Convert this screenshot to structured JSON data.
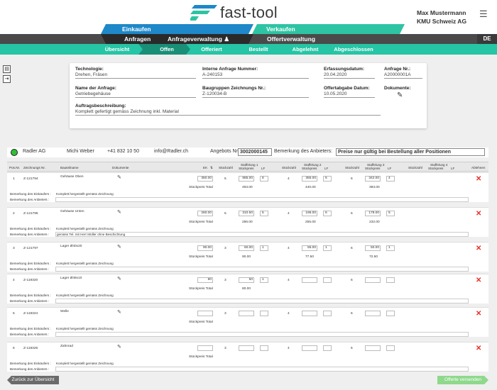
{
  "header": {
    "logo_text": "fast-tool",
    "user_name": "Max Mustermann",
    "user_company": "KMU Schweiz AG"
  },
  "nav": {
    "einkaufen": "Einkaufen",
    "verkaufen": "Verkaufen",
    "anfragen": "Anfragen",
    "anfrageverwaltung": "Anfrageverwaltung",
    "offertverwaltung": "Offertverwaltung",
    "language": "DE"
  },
  "subtabs": [
    "Übersicht",
    "Offen",
    "Offeriert",
    "Bestellt",
    "Abgelehnt",
    "Abgeschlossen"
  ],
  "info": {
    "technologie_label": "Technologie:",
    "technologie": "Drehen, Fräsen",
    "interne_label": "Interne Anfrage Nummer:",
    "interne": "A-240153",
    "erfassung_label": "Erfassungsdatum:",
    "erfassung": "20.04.2020",
    "anfragenr_label": "Anfrage Nr.:",
    "anfragenr": "A20000001A",
    "name_label": "Name der Anfrage:",
    "name": "Getriebegehäuse",
    "baugruppen_label": "Baugruppen Zeichnungs Nr.:",
    "baugruppen": "Z-120034-B",
    "offertabgabe_label": "Offertabgabe Datum:",
    "offertabgabe": "10.05.2020",
    "dokumente_label": "Dokumente:",
    "beschreibung_label": "Auftragsbeschreibung:",
    "beschreibung": "Komplett gefertigt gemäss Zeichnung inkl. Material"
  },
  "supplier": {
    "name": "Radler AG",
    "contact": "Michi Weber",
    "phone": "+41 832 10 50",
    "email": "info@Radler.ch",
    "angebots_label": "Angebots Nr.:",
    "angebots": "3002000145",
    "bemerkung_label": "Bemerkung des Anbieters:",
    "bemerkung": "Preise nur gültig bei Bestellung aller Positionen"
  },
  "table_head": {
    "pos": "Pos.Nr.",
    "zeichnung": "Zeichnungs Nr.",
    "bauteil": "Bauteilname",
    "dokumente": "Dokumente",
    "ek": "EK",
    "stueckzahl": "Stückzahl",
    "staffelung1": "Staffelung 1",
    "staffelung2": "Staffelung 2",
    "staffelung3": "Staffelung 3",
    "staffelung4": "Staffelung 4",
    "stueckpreis": "Stückpreis",
    "lf": "LF",
    "ablehnen": "Ablehnen"
  },
  "labels": {
    "stueckpreis_total": "Stückpreis Total",
    "bem_einkaeufer": "Bemerkung des Einkäufers :",
    "bem_anbieter": "Bemerkung des Anbieters :"
  },
  "rows": [
    {
      "pos": "1",
      "zeichnung": "Z-121794",
      "bauteil": "Gehäuse Oben",
      "ek": "350.00",
      "q1": "5",
      "p1": "885.00",
      "lf1": "8",
      "q2": "4",
      "p2": "355.00",
      "lf2": "6",
      "q3": "6",
      "p3": "342.00",
      "lf3": "4",
      "t1": "493.00",
      "t2": "440.00",
      "t3": "393.00",
      "einkaeufer": "Komplett hergestellt gemäss Zeichnung",
      "anbieter": ""
    },
    {
      "pos": "2",
      "zeichnung": "Z-121795",
      "bauteil": "Gehäuse Unten",
      "ek": "260.00",
      "q1": "5",
      "p1": "310.50",
      "lf1": "5",
      "q2": "4",
      "p2": "195.00",
      "lf2": "6",
      "q3": "6",
      "p3": "178.00",
      "lf3": "5",
      "t1": "286.00",
      "t2": "255.00",
      "t3": "232.00",
      "einkaeufer": "Komplett hergestellt gemäss Zeichnung",
      "anbieter": "gemäss Tel. mit Herr Müller ohne Beschichtung"
    },
    {
      "pos": "3",
      "zeichnung": "Z-121797",
      "bauteil": "Lager Ø40x20",
      "ek": "90.00",
      "q1": "3",
      "p1": "60.00",
      "lf1": "1",
      "q2": "4",
      "p2": "55.00",
      "lf2": "1",
      "q3": "6",
      "p3": "50.00",
      "lf3": "1",
      "t1": "90.00",
      "t2": "77.50",
      "t3": "72.50",
      "einkaeufer": "Komplett hergestellt gemäss Zeichnung",
      "anbieter": ""
    },
    {
      "pos": "4",
      "zeichnung": "Z-119320",
      "bauteil": "Lager Ø48x10",
      "ek": "90",
      "q1": "3",
      "p1": "50",
      "lf1": "1",
      "q2": "4",
      "p2": "",
      "lf2": "",
      "q3": "6",
      "p3": "",
      "lf3": "",
      "t1": "80.00",
      "t2": "",
      "t3": "",
      "einkaeufer": "Komplett hergestellt gemäss Zeichnung",
      "anbieter": ""
    },
    {
      "pos": "5",
      "zeichnung": "Z-119324",
      "bauteil": "Welle",
      "ek": "",
      "q1": "3",
      "p1": "",
      "lf1": "",
      "q2": "4",
      "p2": "",
      "lf2": "",
      "q3": "6",
      "p3": "",
      "lf3": "",
      "t1": "",
      "t2": "",
      "t3": "",
      "einkaeufer": "Komplett hergestellt gemäss Zeichnung",
      "anbieter": ""
    },
    {
      "pos": "6",
      "zeichnung": "Z-119326",
      "bauteil": "Zahnrad",
      "ek": "",
      "q1": "3",
      "p1": "",
      "lf1": "",
      "q2": "4",
      "p2": "",
      "lf2": "",
      "q3": "6",
      "p3": "",
      "lf3": "",
      "t1": "",
      "t2": "",
      "t3": "",
      "einkaeufer": "Komplett hergestellt gemäss Zeichnung",
      "anbieter": ""
    }
  ],
  "buttons": {
    "back": "Zurück zur Übersicht",
    "send": "Offerte versenden"
  },
  "colors": {
    "blue": "#1e88c9",
    "teal": "#2ec4a3",
    "reject": "#e8302a",
    "status": "#2dc136"
  }
}
